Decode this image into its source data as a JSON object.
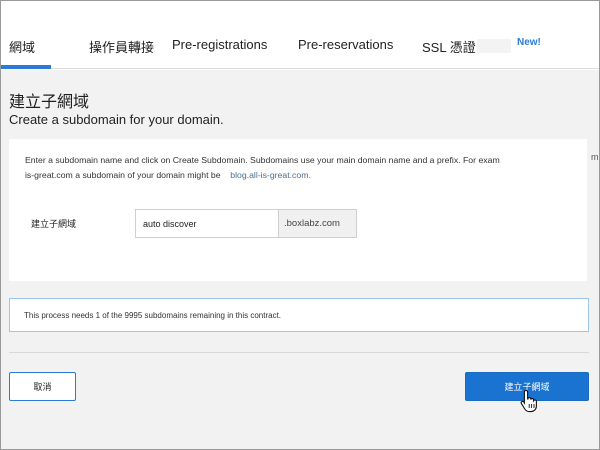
{
  "tabs": [
    {
      "label": "網域",
      "active": true
    },
    {
      "label": "操作員轉接"
    },
    {
      "label": "Pre-registrations"
    },
    {
      "label": "Pre-reservations"
    },
    {
      "label": "SSL 憑證"
    }
  ],
  "new_badge": "New!",
  "page": {
    "title": "建立子網域",
    "subtitle": "Create a subdomain for your domain."
  },
  "instructions": {
    "line1": "Enter a  subdomain name and click on Create Subdomain. Subdomains use your main domain name and a prefix. For exam",
    "line2_prefix": "is-great.com a subdomain of your domain might be",
    "line2_example": "blog.all-is-great.com.",
    "overflow_char": "m"
  },
  "form": {
    "label": "建立子網域",
    "value": "auto discover",
    "suffix": ".boxlabz.com"
  },
  "notice": "This process needs 1 of the 9995 subdomains remaining in this contract.",
  "buttons": {
    "cancel": "取消",
    "create": "建立子網域"
  },
  "colors": {
    "accent": "#2b7bd6",
    "primary_button": "#1a73d0",
    "background": "#f2f2f2"
  }
}
